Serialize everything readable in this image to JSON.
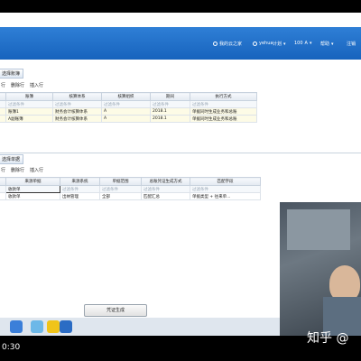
{
  "topbar": {
    "home": "我的云之家",
    "user": "yehua",
    "org": "计划",
    "count": "100",
    "font": "A",
    "help": "帮助",
    "logout": "注销"
  },
  "panel1": {
    "title": "选择账簿",
    "toolbar": [
      "行",
      "删除行",
      "插入行"
    ],
    "columns": [
      "",
      "账簿",
      "核算体系",
      "核算组织",
      "期间",
      "执行方式"
    ],
    "filter": [
      "过滤条件",
      "过滤条件",
      "过滤条件",
      "过滤条件",
      "过滤条件"
    ],
    "rows": [
      [
        "",
        "账簿1",
        "财务会计核算体系",
        "A",
        "2018.1",
        "单据同时生成业务和总账"
      ],
      [
        "",
        "A副账簿",
        "财务会计核算体系",
        "A",
        "2018.1",
        "单据同时生成业务和总账"
      ]
    ]
  },
  "panel2": {
    "title": "选择单据",
    "toolbar": [
      "行",
      "删除行",
      "插入行"
    ],
    "columns": [
      "",
      "来源单据",
      "来源系统",
      "单据范围",
      "总账凭证生成方式",
      "匹配字段"
    ],
    "filter": [
      "收款单",
      "过滤条件",
      "过滤条件",
      "过滤条件",
      "过滤条件"
    ],
    "rows": [
      [
        "",
        "收款单",
        "出纳管理",
        "全部",
        "匹配汇总",
        "单据类型 + 往来单..."
      ]
    ]
  },
  "generate_button": "凭证生成",
  "clock": "0:30",
  "watermark": "知乎 @"
}
